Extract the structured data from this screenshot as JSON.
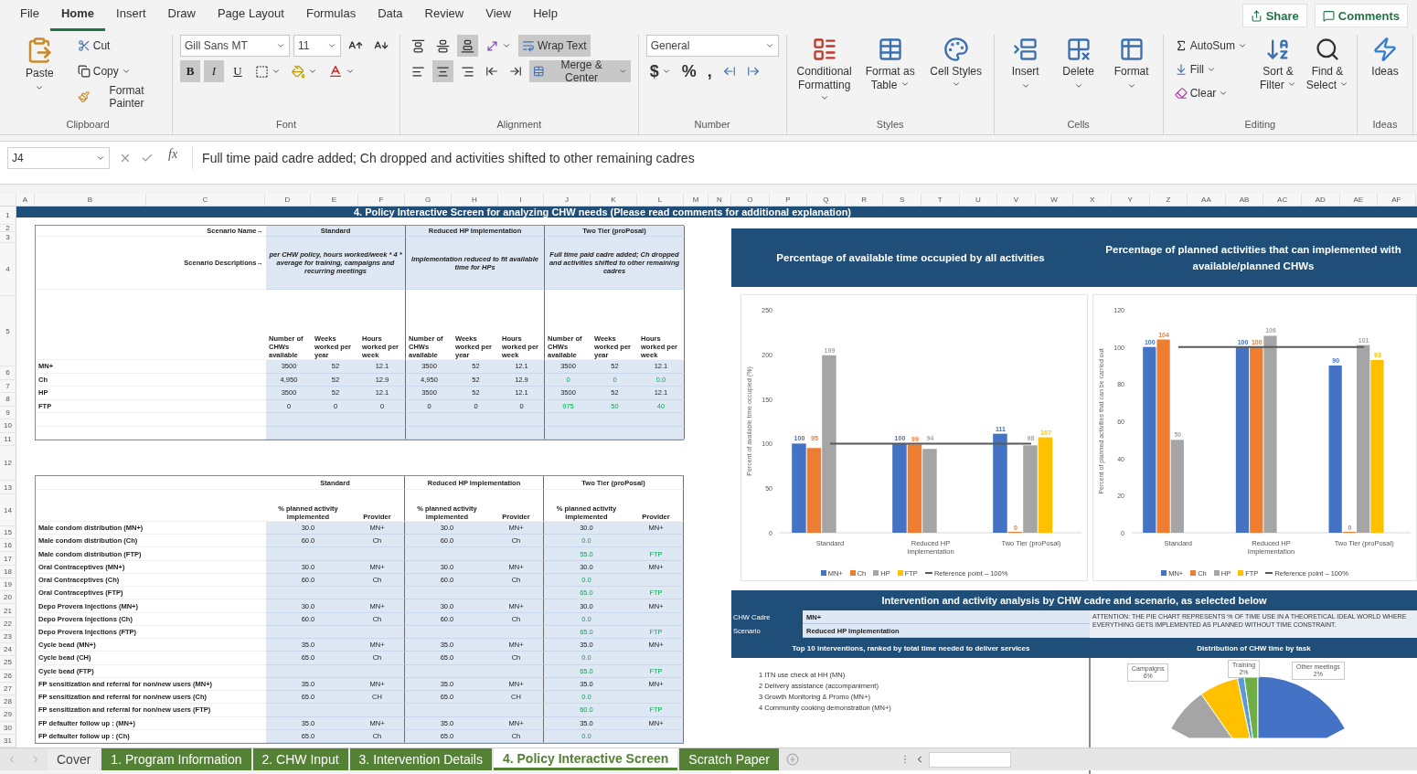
{
  "menu": {
    "tabs": [
      {
        "label": "File",
        "selected": false
      },
      {
        "label": "Home",
        "selected": true
      },
      {
        "label": "Insert",
        "selected": false
      },
      {
        "label": "Draw",
        "selected": false
      },
      {
        "label": "Page Layout",
        "selected": false
      },
      {
        "label": "Formulas",
        "selected": false
      },
      {
        "label": "Data",
        "selected": false
      },
      {
        "label": "Review",
        "selected": false
      },
      {
        "label": "View",
        "selected": false
      },
      {
        "label": "Help",
        "selected": false
      }
    ],
    "share": "Share",
    "comments": "Comments"
  },
  "ribbon": {
    "clipboard": {
      "paste": "Paste",
      "cut": "Cut",
      "copy": "Copy",
      "format_painter": "Format Painter",
      "label": "Clipboard"
    },
    "font": {
      "name": "Gill Sans MT",
      "size": "11",
      "toggles": [
        {
          "label": "B",
          "on": true
        },
        {
          "label": "I",
          "on": true
        },
        {
          "label": "U",
          "on": false
        }
      ],
      "label": "Font"
    },
    "alignment": {
      "vertical": [
        {
          "kind": "top",
          "on": false
        },
        {
          "kind": "middle",
          "on": false
        },
        {
          "kind": "bottom",
          "on": true
        }
      ],
      "horizontal": [
        {
          "kind": "left",
          "on": false
        },
        {
          "kind": "center",
          "on": true
        },
        {
          "kind": "right",
          "on": false
        }
      ],
      "wrap_text": {
        "label": "Wrap Text",
        "on": true
      },
      "merge": {
        "label": "Merge & Center",
        "on": true
      },
      "label": "Alignment"
    },
    "number": {
      "format": "General",
      "currency": "$",
      "percent": "%",
      "comma": ",",
      "label": "Number"
    },
    "styles": {
      "buttons": [
        "Conditional Formatting",
        "Format as Table",
        "Cell Styles"
      ],
      "label": "Styles"
    },
    "cells": {
      "buttons": [
        "Insert",
        "Delete",
        "Format"
      ],
      "label": "Cells"
    },
    "editing": {
      "autosum": "AutoSum",
      "fill": "Fill",
      "clear": "Clear",
      "sort": "Sort & Filter",
      "find": "Find & Select",
      "label": "Editing"
    },
    "ideas": {
      "button": "Ideas",
      "label": "Ideas"
    }
  },
  "formula_bar": {
    "name_box": "J4",
    "function_symbol": "fx",
    "formula": "Full time paid cadre added; Ch dropped and activities shifted to other remaining cadres"
  },
  "columns": [
    "A",
    "B",
    "C",
    "D",
    "E",
    "F",
    "G",
    "H",
    "I",
    "J",
    "K",
    "L",
    "M",
    "N",
    "O",
    "P",
    "Q",
    "R",
    "S",
    "T",
    "U",
    "V",
    "W",
    "X",
    "Y",
    "Z",
    "AA",
    "AB",
    "AC",
    "AD",
    "AE",
    "AF"
  ],
  "rows": [
    "1",
    "2",
    "3",
    "4",
    "5",
    "6",
    "7",
    "8",
    "9",
    "10",
    "11",
    "12",
    "13",
    "14",
    "15",
    "16",
    "17",
    "18",
    "19",
    "20",
    "21",
    "22",
    "23",
    "24",
    "25",
    "26",
    "27",
    "28",
    "29",
    "30",
    "31"
  ],
  "title": "4. Policy Interactive Screen for analyzing CHW needs (Please read comments for additional explanation)",
  "capacity_table": {
    "name_label": "Scenario Name→",
    "description_label": "Scenario Descriptions→",
    "scenarios": [
      {
        "name": "Standard",
        "description": "per CHW policy, hours worked/week * 4 * average for training, campaigns and recurring meetings",
        "column_heads": [
          "Number of CHWs available",
          "Weeks worked per year",
          "Hours worked per week"
        ]
      },
      {
        "name": "Reduced HP Implementation",
        "description": "Implementation reduced to fit available time for HPs",
        "column_heads": [
          "Number of CHWs available",
          "Weeks worked per year",
          "Hours worked per week"
        ]
      },
      {
        "name": "Two Tier (proPosal)",
        "description": "Full time paid cadre added; Ch dropped and activities shifted to other remaining cadres",
        "column_heads": [
          "Number of CHWs available",
          "Weeks worked per year",
          "Hours worked per week"
        ]
      }
    ],
    "rows": [
      {
        "label": "MN+",
        "scenarios": [
          {
            "values": [
              "3500",
              "52",
              "12.1"
            ],
            "changed": false
          },
          {
            "values": [
              "3500",
              "52",
              "12.1"
            ],
            "changed": false
          },
          {
            "values": [
              "3500",
              "52",
              "12.1"
            ],
            "changed": false
          }
        ]
      },
      {
        "label": "Ch",
        "scenarios": [
          {
            "values": [
              "4,950",
              "52",
              "12.9"
            ],
            "changed": false
          },
          {
            "values": [
              "4,950",
              "52",
              "12.9"
            ],
            "changed": false
          },
          {
            "values": [
              "0",
              "0",
              "0.0"
            ],
            "changed": true
          }
        ]
      },
      {
        "label": "HP",
        "scenarios": [
          {
            "values": [
              "3500",
              "52",
              "12.1"
            ],
            "changed": false
          },
          {
            "values": [
              "3500",
              "52",
              "12.1"
            ],
            "changed": false
          },
          {
            "values": [
              "3500",
              "52",
              "12.1"
            ],
            "changed": false
          }
        ]
      },
      {
        "label": "FTP",
        "scenarios": [
          {
            "values": [
              "0",
              "0",
              "0"
            ],
            "changed": false
          },
          {
            "values": [
              "0",
              "0",
              "0"
            ],
            "changed": false
          },
          {
            "values": [
              "975",
              "50",
              "40"
            ],
            "changed": true
          }
        ]
      }
    ]
  },
  "activity_table": {
    "scenarios": [
      {
        "name": "Standard",
        "column_heads": [
          "% planned activity implemented",
          "Provider"
        ]
      },
      {
        "name": "Reduced HP Implementation",
        "column_heads": [
          "% planned activity implemented",
          "Provider"
        ]
      },
      {
        "name": "Two Tier (proPosal)",
        "column_heads": [
          "% planned activity implemented",
          "Provider"
        ]
      }
    ],
    "rows": [
      {
        "label": "Male condom distribution (MN+)",
        "standard": {
          "percent": "30.0",
          "provider": "MN+",
          "changed": false
        },
        "reduced_hp": {
          "percent": "30.0",
          "provider": "MN+",
          "changed": false
        },
        "two_tier": {
          "percent": "30.0",
          "provider": "MN+",
          "changed": false
        }
      },
      {
        "label": "Male condom distribution (Ch)",
        "standard": {
          "percent": "60.0",
          "provider": "Ch",
          "changed": false
        },
        "reduced_hp": {
          "percent": "60.0",
          "provider": "Ch",
          "changed": false
        },
        "two_tier": {
          "percent": "0.0",
          "changed": true
        }
      },
      {
        "label": "Male condom distribution (FTP)",
        "two_tier": {
          "percent": "55.0",
          "provider": "FTP",
          "changed": true
        }
      },
      {
        "label": "Oral Contraceptives (MN+)",
        "standard": {
          "percent": "30.0",
          "provider": "MN+",
          "changed": false
        },
        "reduced_hp": {
          "percent": "30.0",
          "provider": "MN+",
          "changed": false
        },
        "two_tier": {
          "percent": "30.0",
          "provider": "MN+",
          "changed": false
        }
      },
      {
        "label": "Oral Contraceptives (Ch)",
        "standard": {
          "percent": "60.0",
          "provider": "Ch",
          "changed": false
        },
        "reduced_hp": {
          "percent": "60.0",
          "provider": "Ch",
          "changed": false
        },
        "two_tier": {
          "percent": "0.0",
          "changed": true
        }
      },
      {
        "label": "Oral Contraceptives (FTP)",
        "two_tier": {
          "percent": "65.0",
          "provider": "FTP",
          "changed": true
        }
      },
      {
        "label": "Depo Provera Injections (MN+)",
        "standard": {
          "percent": "30.0",
          "provider": "MN+",
          "changed": false
        },
        "reduced_hp": {
          "percent": "30.0",
          "provider": "MN+",
          "changed": false
        },
        "two_tier": {
          "percent": "30.0",
          "provider": "MN+",
          "changed": false
        }
      },
      {
        "label": "Depo Provera Injections (Ch)",
        "standard": {
          "percent": "60.0",
          "provider": "Ch",
          "changed": false
        },
        "reduced_hp": {
          "percent": "60.0",
          "provider": "Ch",
          "changed": false
        },
        "two_tier": {
          "percent": "0.0",
          "changed": true
        }
      },
      {
        "label": "Depo Provera Injections (FTP)",
        "two_tier": {
          "percent": "65.0",
          "provider": "FTP",
          "changed": true
        }
      },
      {
        "label": "Cycle bead (MN+)",
        "standard": {
          "percent": "35.0",
          "provider": "MN+",
          "changed": false
        },
        "reduced_hp": {
          "percent": "35.0",
          "provider": "MN+",
          "changed": false
        },
        "two_tier": {
          "percent": "35.0",
          "provider": "MN+",
          "changed": false
        }
      },
      {
        "label": "Cycle bead (CH)",
        "standard": {
          "percent": "65.0",
          "provider": "Ch",
          "changed": false
        },
        "reduced_hp": {
          "percent": "65.0",
          "provider": "Ch",
          "changed": false
        },
        "two_tier": {
          "percent": "0.0",
          "changed": true
        }
      },
      {
        "label": "Cycle bead (FTP)",
        "two_tier": {
          "percent": "65.0",
          "provider": "FTP",
          "changed": true
        }
      },
      {
        "label": "FP sensitization and referral for non/new users (MN+)",
        "standard": {
          "percent": "35.0",
          "provider": "MN+",
          "changed": false
        },
        "reduced_hp": {
          "percent": "35.0",
          "provider": "MN+",
          "changed": false
        },
        "two_tier": {
          "percent": "35.0",
          "provider": "MN+",
          "changed": false
        }
      },
      {
        "label": "FP sensitization and referral for non/new users (Ch)",
        "standard": {
          "percent": "65.0",
          "provider": "CH",
          "changed": false
        },
        "reduced_hp": {
          "percent": "65.0",
          "provider": "CH",
          "changed": false
        },
        "two_tier": {
          "percent": "0.0",
          "changed": true
        }
      },
      {
        "label": "FP sensitization and referral for non/new users (FTP)",
        "two_tier": {
          "percent": "60.0",
          "provider": "FTP",
          "changed": true
        }
      },
      {
        "label": "FP defaulter follow up : (MN+)",
        "standard": {
          "percent": "35.0",
          "provider": "MN+",
          "changed": false
        },
        "reduced_hp": {
          "percent": "35.0",
          "provider": "MN+",
          "changed": false
        },
        "two_tier": {
          "percent": "35.0",
          "provider": "MN+",
          "changed": false
        }
      },
      {
        "label": "FP defaulter follow up : (Ch)",
        "standard": {
          "percent": "65.0",
          "provider": "Ch",
          "changed": false
        },
        "reduced_hp": {
          "percent": "65.0",
          "provider": "Ch",
          "changed": false
        },
        "two_tier": {
          "percent": "0.0",
          "changed": true
        }
      }
    ]
  },
  "chart_headers": [
    "Percentage of available time occupied by all activities",
    "Percentage of planned activities that can implemented with available/planned CHWs"
  ],
  "charts": [
    {
      "chart_data": {
        "type": "bar",
        "ylabel": "Percent of available time occupied (%)",
        "categories": [
          "Standard",
          "Reduced HP Implementation",
          "Two Tier (proPosal)"
        ],
        "series": [
          {
            "name": "MN+",
            "color": "#4472c4",
            "values": [
              100,
              100,
              111
            ]
          },
          {
            "name": "Ch",
            "color": "#ed7d31",
            "values": [
              95,
              99,
              0
            ]
          },
          {
            "name": "HP",
            "color": "#a5a5a5",
            "values": [
              199,
              94,
              98
            ]
          },
          {
            "name": "FTP",
            "color": "#ffc000",
            "values": [
              null,
              null,
              107
            ]
          },
          {
            "name": "Reference point – 100%",
            "color": "#595959",
            "values": [
              100,
              100,
              100
            ],
            "type": "line"
          }
        ],
        "ylim": [
          0,
          250
        ],
        "yticks": [
          0,
          50,
          100,
          150,
          200,
          250
        ],
        "value_labels": [
          [
            "100",
            "100",
            "111"
          ],
          [
            "95",
            "99",
            "0"
          ],
          [
            "199",
            "94",
            "98"
          ],
          [
            null,
            null,
            "107"
          ],
          [
            null,
            null,
            null
          ]
        ],
        "legend": "bottom"
      }
    },
    {
      "chart_data": {
        "type": "bar",
        "ylabel": "Percent of planned activities that can be carried out",
        "categories": [
          "Standard",
          "Reduced HP Implementation",
          "Two Tier (proPosal)"
        ],
        "series": [
          {
            "name": "MN+",
            "color": "#4472c4",
            "values": [
              100,
              100,
              90
            ]
          },
          {
            "name": "Ch",
            "color": "#ed7d31",
            "values": [
              104,
              100,
              0
            ]
          },
          {
            "name": "HP",
            "color": "#a5a5a5",
            "values": [
              50,
              106,
              101
            ]
          },
          {
            "name": "FTP",
            "color": "#ffc000",
            "values": [
              null,
              null,
              93
            ]
          },
          {
            "name": "Reference point – 100%",
            "color": "#595959",
            "values": [
              100,
              100,
              100
            ],
            "type": "line"
          }
        ],
        "ylim": [
          0,
          120
        ],
        "yticks": [
          0,
          20,
          40,
          60,
          80,
          100,
          120
        ],
        "value_labels": [
          [
            "100",
            "100",
            "90"
          ],
          [
            "104",
            "100",
            "0"
          ],
          [
            "50",
            "106",
            "101"
          ],
          [
            null,
            null,
            "93"
          ],
          [
            null,
            null,
            null
          ]
        ],
        "legend": "bottom"
      }
    }
  ],
  "analysis": {
    "title": "Intervention and activity analysis by CHW cadre and scenario, as selected below",
    "cadre_label": "CHW Cadre",
    "scenario_label": "Scenario",
    "cadre": "MN+",
    "scenario": "Reduced HP Implementation",
    "attention": "ATTENTION: THE PIE CHART REPRESENTS % OF TIME USE IN A THEORETICAL IDEAL WORLD WHERE EVERYTHING GETS IMPLEMENTED AS PLANNED WITHOUT TIME CONSTRAINT.",
    "top_title": "Top 10 interventions, ranked by total time needed to deliver services",
    "top_items": [
      "1 ITN use check at HH (MN)",
      "2 Delivery assistance (accompaniment)",
      "3 Growth Monitoring & Promo (MN+)",
      "4 Community cooking demonstration (MN+)"
    ],
    "pie_title": "Distribution of CHW time by task",
    "pie_labels": [
      {
        "name": "Campaigns",
        "value": "6%"
      },
      {
        "name": "Training",
        "value": "2%"
      },
      {
        "name": "Other meetings",
        "value": "2%"
      }
    ]
  },
  "sheet_tabs": [
    {
      "label": "Cover",
      "selected": false
    },
    {
      "label": "1. Program Information",
      "selected": false,
      "color": "#548235"
    },
    {
      "label": "2. CHW Input",
      "selected": false,
      "color": "#548235"
    },
    {
      "label": "3. Intervention Details",
      "selected": false,
      "color": "#548235"
    },
    {
      "label": "4. Policy Interactive Screen",
      "selected": true,
      "color": "#548235"
    },
    {
      "label": "Scratch Paper",
      "selected": false,
      "color": "#548235"
    }
  ]
}
